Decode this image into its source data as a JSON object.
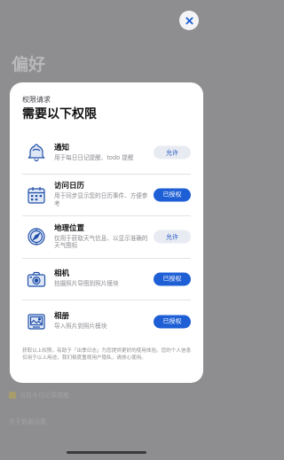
{
  "background": {
    "title": "偏好",
    "rows": [
      "当前今日记录提醒",
      "关于数据设置"
    ]
  },
  "close": {
    "icon": "close-icon"
  },
  "modal": {
    "kicker": "权限请求",
    "title": "需要以下权限",
    "permissions": [
      {
        "name": "通知",
        "desc": "用于每日日记提醒、todo 提醒",
        "button": "允许",
        "state": "allow",
        "icon": "bell-icon"
      },
      {
        "name": "访问日历",
        "desc": "用于同步显示您的日历事件、方便参考",
        "button": "已授权",
        "state": "granted",
        "icon": "calendar-icon"
      },
      {
        "name": "地理位置",
        "desc": "仅用于获取天气信息、以显示准确的天气图标",
        "button": "允许",
        "state": "allow",
        "icon": "compass-icon"
      },
      {
        "name": "相机",
        "desc": "拍摄照片导图到照片模块",
        "button": "已授权",
        "state": "granted",
        "icon": "camera-icon"
      },
      {
        "name": "相册",
        "desc": "导入照片到照片模块",
        "button": "已授权",
        "state": "granted",
        "icon": "photo-album-icon"
      }
    ],
    "footer": "获取以上权限，有助于「出季日志」为您提供更好的使用体验。您的个人信息仅用于以上用途，我们极度重视用户隐私，请放心使用。"
  },
  "colors": {
    "accent": "#1e5fd6",
    "allow_bg": "#e9ebf2",
    "icon": "#1f4fa8"
  }
}
